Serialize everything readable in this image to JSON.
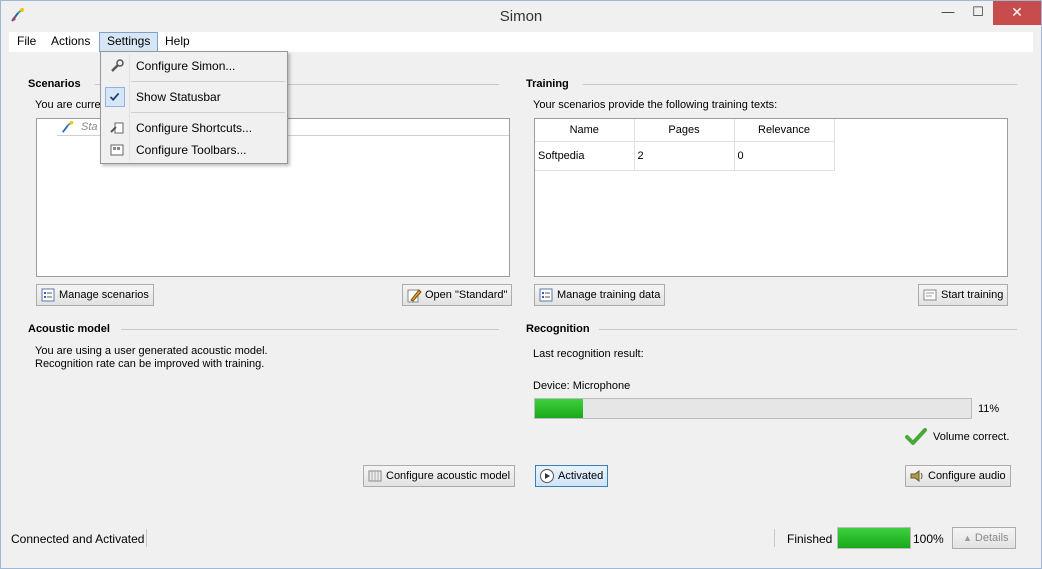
{
  "window": {
    "title": "Simon"
  },
  "menubar": {
    "items": [
      {
        "label": "File"
      },
      {
        "label": "Actions"
      },
      {
        "label": "Settings"
      },
      {
        "label": "Help"
      }
    ]
  },
  "settings_menu": {
    "items": [
      {
        "label": "Configure Simon...",
        "icon": "wrench-icon"
      },
      {
        "label": "Show Statusbar",
        "icon": "checkmark-icon",
        "checked": true
      },
      {
        "label": "Configure Shortcuts...",
        "icon": "shortcut-icon"
      },
      {
        "label": "Configure Toolbars...",
        "icon": "toolbar-icon"
      }
    ]
  },
  "scenarios": {
    "title": "Scenarios",
    "description": "You are curre",
    "list_item": "Sta",
    "manage_button": "Manage scenarios",
    "open_button": "Open \"Standard\""
  },
  "training": {
    "title": "Training",
    "description": "Your scenarios provide the following training texts:",
    "columns": [
      "Name",
      "Pages",
      "Relevance"
    ],
    "rows": [
      {
        "name": "Softpedia",
        "pages": "2",
        "relevance": "0"
      }
    ],
    "manage_button": "Manage training data",
    "start_button": "Start training"
  },
  "acoustic_model": {
    "title": "Acoustic model",
    "line1": "You are using a user generated acoustic model.",
    "line2": "Recognition rate can be improved with training.",
    "configure_button": "Configure acoustic model"
  },
  "recognition": {
    "title": "Recognition",
    "last_result_label": "Last recognition result:",
    "device_label": "Device: Microphone",
    "volume_percent": 11,
    "volume_text": "11%",
    "volume_status": "Volume correct.",
    "activated_button": "Activated",
    "configure_audio_button": "Configure audio"
  },
  "statusbar": {
    "status": "Connected and Activated",
    "progress_label": "Finished",
    "progress_percent": 100,
    "progress_text": "100%",
    "details_button": "Details"
  },
  "colors": {
    "accent": "#3c7fb1",
    "progress_green": "#1aa81a",
    "close_red": "#c74d4d"
  }
}
